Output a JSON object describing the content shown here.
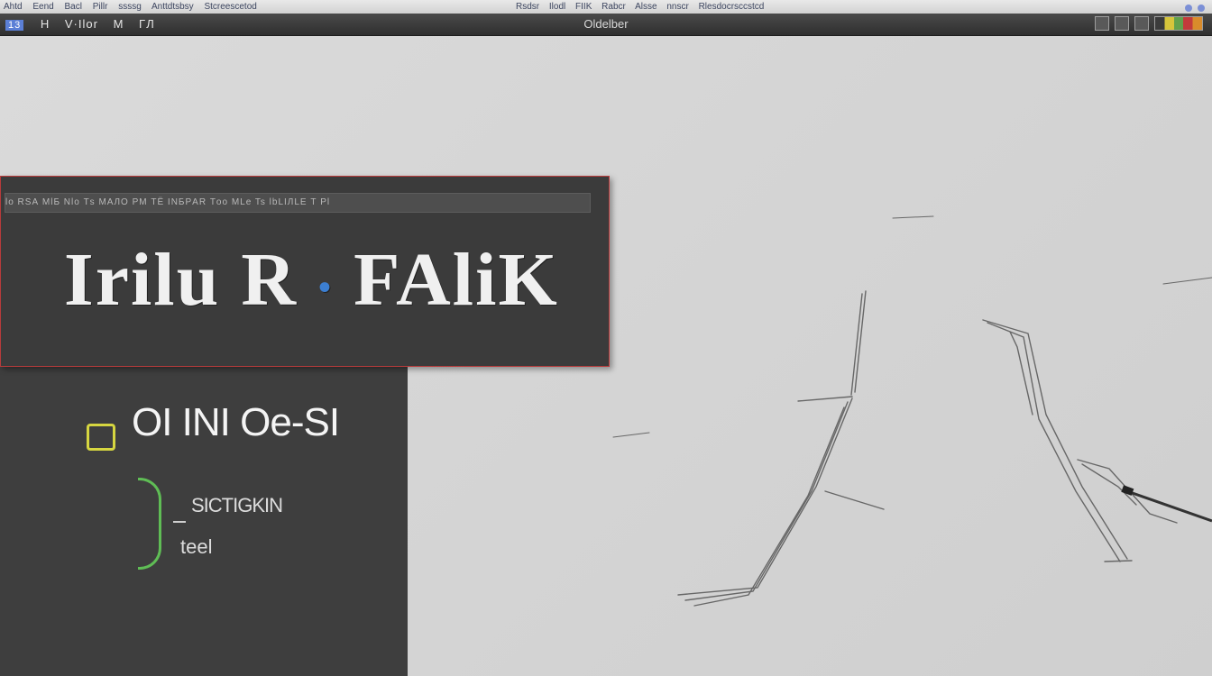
{
  "menubar": {
    "items": [
      "Ahtd",
      "Eend",
      "Bacl",
      "Pillr",
      "ssssg",
      "Anttdtsbsy",
      "Stcreescetod"
    ],
    "center_items": [
      "Rsdsr",
      "Ilodl",
      "FIIK",
      "Rabcr",
      "Alsse",
      "nnscr",
      "Rlesdocrsccstcd"
    ]
  },
  "titlebar": {
    "tool_number": "13",
    "tools": [
      "H",
      "V·Ilor",
      "M",
      "ΓЛ"
    ],
    "window_title": "Oldelber"
  },
  "banner": {
    "toolbar_text": "lo RSА  MlБ Nlo  Тs  MAЛО  PM  ТЁ INБРAR  Тoo  MLe  Ts  lbLIЛLE  Т  Pl",
    "big_text_left": "Irilu ",
    "big_text_mid": "R",
    "big_text_right": " FAliK",
    "accent": "•"
  },
  "panel": {
    "heading": "OI INI Oe-SI",
    "sub1": "SICTIGKIN",
    "sub2": "teel"
  },
  "colors": {
    "banner_border": "#b83b3b",
    "knob": "#d6d640",
    "bracket": "#5fbd55",
    "accent_blue": "#3c7fd2"
  }
}
